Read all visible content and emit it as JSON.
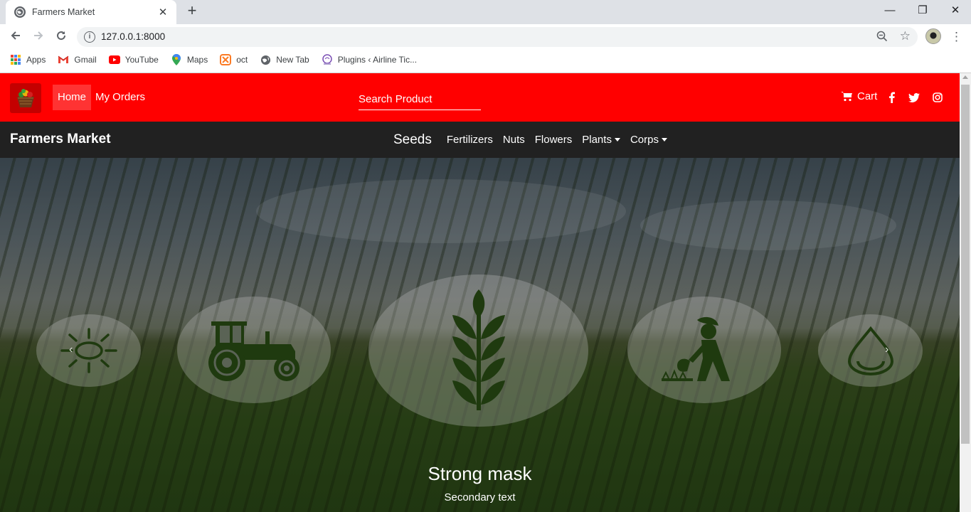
{
  "browser": {
    "tab_title": "Farmers Market",
    "url": "127.0.0.1:8000",
    "bookmarks": [
      {
        "label": "Apps",
        "icon": "apps-grid-icon"
      },
      {
        "label": "Gmail",
        "icon": "gmail-icon"
      },
      {
        "label": "YouTube",
        "icon": "youtube-icon"
      },
      {
        "label": "Maps",
        "icon": "maps-pin-icon"
      },
      {
        "label": "oct",
        "icon": "xampp-icon"
      },
      {
        "label": "New Tab",
        "icon": "globe-icon"
      },
      {
        "label": "Plugins ‹ Airline Tic...",
        "icon": "plugin-icon"
      }
    ]
  },
  "topnav": {
    "home": "Home",
    "my_orders": "My Orders",
    "search_placeholder": "Search Product",
    "cart": "Cart",
    "social_icons": [
      "facebook-icon",
      "twitter-icon",
      "instagram-icon"
    ],
    "accent": "#ff0000"
  },
  "catnav": {
    "brand": "Farmers Market",
    "items": [
      {
        "label": "Seeds"
      },
      {
        "label": "Fertilizers"
      },
      {
        "label": "Nuts"
      },
      {
        "label": "Flowers"
      },
      {
        "label": "Plants",
        "dropdown": true
      },
      {
        "label": "Corps",
        "dropdown": true
      }
    ],
    "background": "#212121"
  },
  "hero": {
    "carousel_icons": [
      "sun-icon",
      "tractor-icon",
      "wheat-icon",
      "farmer-digging-icon",
      "water-drop-icon"
    ],
    "caption_title": "Strong mask",
    "caption_subtitle": "Secondary text",
    "icon_color": "#1f3a0f"
  }
}
